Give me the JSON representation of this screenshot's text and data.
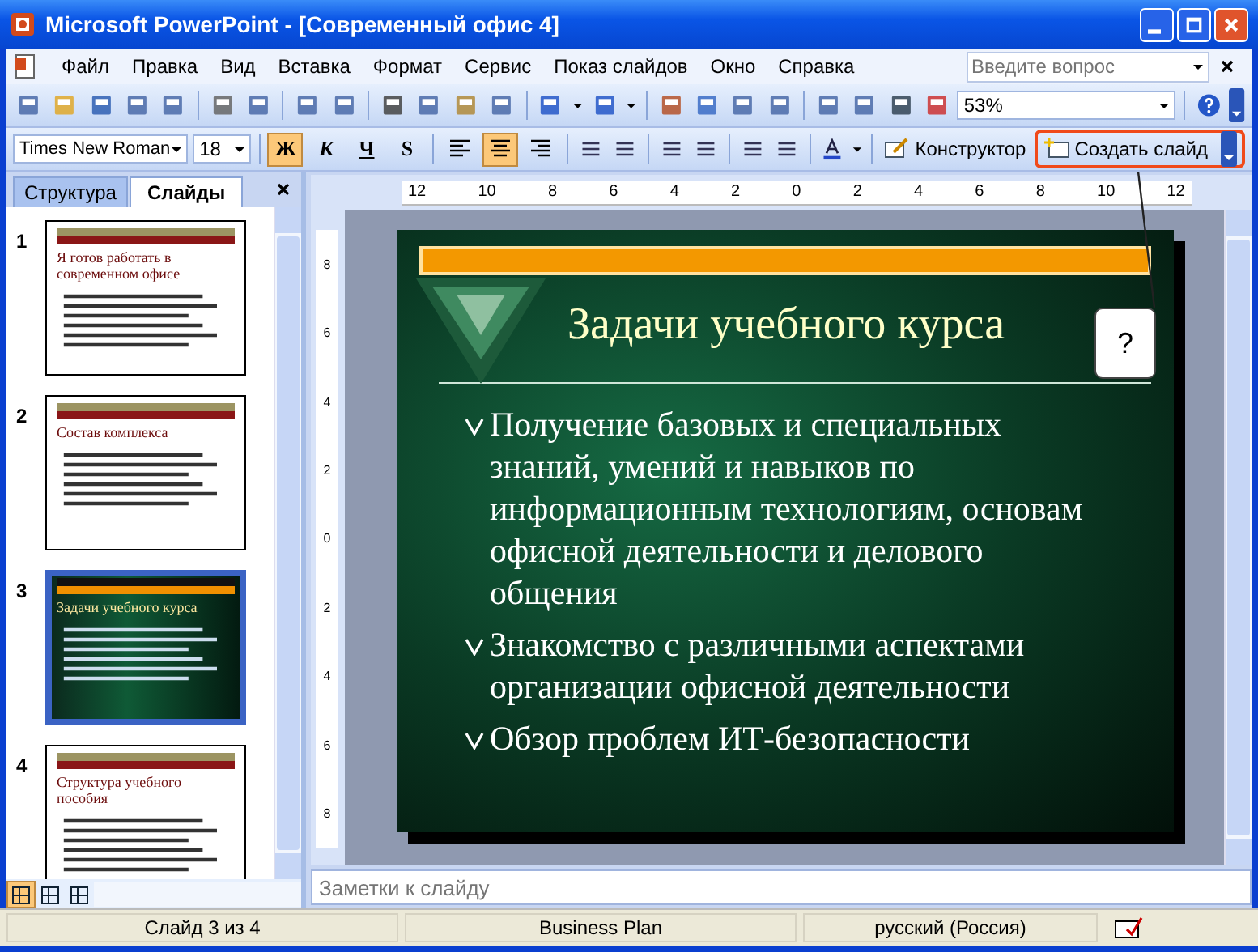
{
  "window": {
    "title": "Microsoft PowerPoint - [Современный офис 4]"
  },
  "menu": [
    "Файл",
    "Правка",
    "Вид",
    "Вставка",
    "Формат",
    "Сервис",
    "Показ слайдов",
    "Окно",
    "Справка"
  ],
  "help_search": {
    "placeholder": "Введите вопрос"
  },
  "standard_toolbar": {
    "zoom": "53%"
  },
  "formatting_toolbar": {
    "font": "Times New Roman",
    "size": "18",
    "styles": [
      {
        "label": "Ж",
        "kind": "bold",
        "on": true
      },
      {
        "label": "К",
        "kind": "italic",
        "on": false
      },
      {
        "label": "Ч",
        "kind": "underline",
        "on": false
      },
      {
        "label": "S",
        "kind": "shadow",
        "on": false
      }
    ],
    "align": [
      {
        "selected": false
      },
      {
        "selected": true
      },
      {
        "selected": false
      }
    ],
    "design_button": "Конструктор",
    "new_slide_button": "Создать слайд"
  },
  "pane_tabs": [
    {
      "label": "Структура",
      "selected": false
    },
    {
      "label": "Слайды",
      "selected": true
    }
  ],
  "thumbnails": [
    {
      "number": "1",
      "kind": "light",
      "selected": false,
      "title": "Я готов работать в современном офисе"
    },
    {
      "number": "2",
      "kind": "light",
      "selected": false,
      "title": "Состав комплекса"
    },
    {
      "number": "3",
      "kind": "dark",
      "selected": true,
      "title": "Задачи учебного курса"
    },
    {
      "number": "4",
      "kind": "light",
      "selected": false,
      "title": "Структура учебного пособия"
    }
  ],
  "view_buttons": [
    {
      "selected": true
    },
    {
      "selected": false
    },
    {
      "selected": false
    }
  ],
  "ruler": {
    "horizontal": [
      "12",
      "10",
      "8",
      "6",
      "4",
      "2",
      "0",
      "2",
      "4",
      "6",
      "8",
      "10",
      "12"
    ],
    "vertical": [
      "8",
      "6",
      "4",
      "2",
      "0",
      "2",
      "4",
      "6",
      "8"
    ]
  },
  "slide": {
    "title": "Задачи учебного курса",
    "bullets": [
      "Получение базовых и специальных знаний, умений и навыков по информационным технологиям, основам офисной деятельности и делового общения",
      "Знакомство с различными аспектами организации офисной деятельности",
      "Обзор проблем ИТ-безопасности"
    ]
  },
  "callout": "?",
  "notes": {
    "placeholder": "Заметки к слайду"
  },
  "status_bar": {
    "slide": "Слайд 3 из 4",
    "design": "Business Plan",
    "language": "русский (Россия)"
  }
}
